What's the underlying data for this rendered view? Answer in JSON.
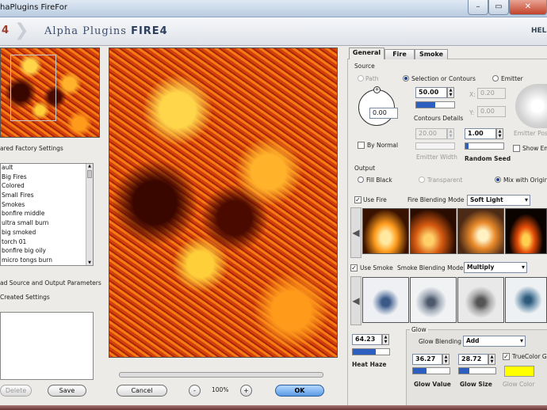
{
  "window": {
    "title": "haPlugins FireFor"
  },
  "banner": {
    "left_mark": "4",
    "logo": "Alpha Plugins",
    "logo_bold": "FIRE4",
    "help": "HEL"
  },
  "left": {
    "presets_title": "ared Factory Settings",
    "presets": [
      "ault",
      "Big Fires",
      "Colored",
      "Small Fires",
      "Smokes",
      "bonfire middle",
      "ultra small burn",
      "big smoked",
      "torch 01",
      "bonfire big oily",
      "micro tongs burn"
    ],
    "load_label": "ad Source and Output Parameters",
    "created_title": "Created Settings",
    "delete_label": "Delete",
    "save_label": "Save"
  },
  "preview": {
    "cancel_label": "Cancel",
    "zoom_out": "-",
    "zoom": "100%",
    "zoom_in": "+",
    "ok_label": "OK"
  },
  "tabs": [
    "General",
    "Fire",
    "Smoke"
  ],
  "source": {
    "title": "Source",
    "opt_path": "Path",
    "opt_selection": "Selection or Contours",
    "opt_emitter": "Emitter",
    "angle_value": "0.00",
    "by_normal": "By Normal",
    "contours_value": "50.00",
    "contours_label": "Contours Details",
    "emitter_width_value": "20.00",
    "emitter_width_label": "Emitter Width",
    "random_seed_value": "1.00",
    "random_seed_label": "Random Seed",
    "x_label": "X:",
    "x_value": "0.20",
    "y_label": "Y:",
    "y_value": "0.00",
    "emitter_pos_label": "Emitter Posi",
    "show_em_label": "Show Em"
  },
  "output": {
    "title": "Output",
    "fill_black": "Fill Black",
    "transparent": "Transparent",
    "mix": "Mix with Origina"
  },
  "fire_row": {
    "use_label": "Use Fire",
    "mode_label": "Fire Blending Mode",
    "mode_value": "Soft Light"
  },
  "smoke_row": {
    "use_label": "Use Smoke",
    "mode_label": "Smoke Blending Mode",
    "mode_value": "Multiply"
  },
  "heat": {
    "value": "64.23",
    "label": "Heat Haze"
  },
  "glow": {
    "title": "Glow",
    "blending_label": "Glow Blending",
    "blending_value": "Add",
    "value": "36.27",
    "value_label": "Glow Value",
    "size": "28.72",
    "size_label": "Glow Size",
    "truecolor_label": "TrueColor Gl",
    "color_label": "Glow Color",
    "color": "#ffff00"
  },
  "colors": {
    "accent": "#2d5fc0",
    "glow_swatch": "#ffff00",
    "ok_button": "#5a9be3"
  }
}
